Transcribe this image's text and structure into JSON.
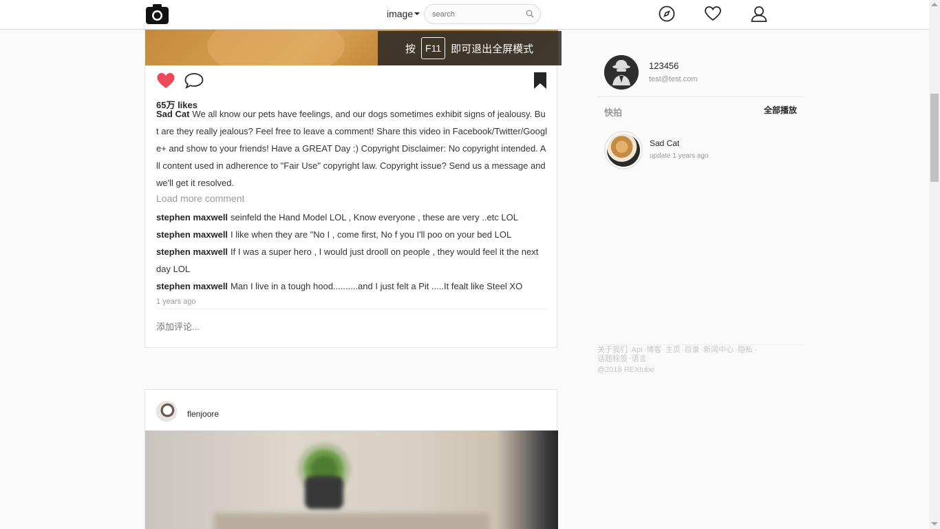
{
  "header": {
    "nav_dropdown_label": "image",
    "search_placeholder": "search"
  },
  "toast": {
    "prefix": "按",
    "key": "F11",
    "suffix": "即可退出全屏模式"
  },
  "post": {
    "likes": "65万 likes",
    "author": "Sad Cat",
    "caption": "We all know our pets have feelings, and our dogs sometimes exhibit signs of jealousy. But are they really jealous? Feel free to leave a comment! Share this video in Facebook/Twitter/Google+ and show to your friends! Have a GREAT Day :) Copyright Disclaimer: No copyright intended. All content used in adherence to \"Fair Use\" copyright law. Copyright issue? Send us a message and we'll get it resolved.",
    "load_more": "Load more comment",
    "comments": [
      {
        "user": "stephen maxwell",
        "text": "seinfeld the Hand Model LOL , Know everyone , these are very ..etc LOL"
      },
      {
        "user": "stephen maxwell",
        "text": "I like when they are \"No I , come first, No f you I'll poo on your bed LOL"
      },
      {
        "user": "stephen maxwell",
        "text": "If I was a super hero , I would just drooll on people , they would feel it the next day LOL"
      },
      {
        "user": "stephen maxwell",
        "text": "Man I live in a tough hood..........and I just felt a Pit .....It fealt like Steel XO"
      }
    ],
    "time_ago": "1 years ago",
    "add_comment_placeholder": "添加评论..."
  },
  "post2": {
    "username": "flenjoore"
  },
  "sidebar": {
    "username": "123456",
    "email": "test@test.com",
    "section_title": "快拍",
    "play_all": "全部播放",
    "story": {
      "name": "Sad Cat",
      "meta": "update 1 years ago"
    },
    "footer_links": [
      "关于我们",
      "Api",
      "博客",
      "主页",
      "目录",
      "新闻中心",
      "隐私",
      "话题标签",
      "语言"
    ],
    "copyright": "@2018 REXtube"
  },
  "colors": {
    "like_red": "#ed4956",
    "text_dark": "#262626",
    "muted": "#999999"
  }
}
